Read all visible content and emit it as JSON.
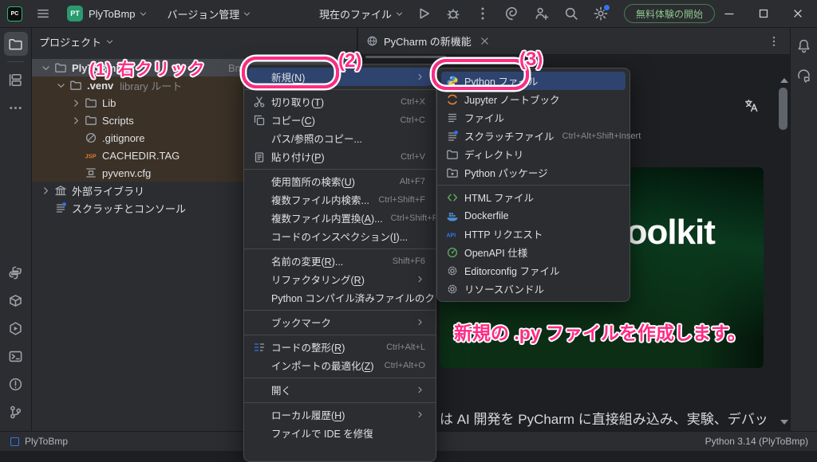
{
  "titlebar": {
    "left_icons": [
      "pycharm-logo",
      "main-menu"
    ],
    "logo_text": "PC",
    "project_chip": "PT",
    "project_name": "PlyToBmp",
    "vcs_label": "バージョン管理",
    "run_config_label": "現在のファイル",
    "action_icons": [
      "run",
      "debug",
      "more-actions",
      "ai-assistant",
      "code-with-me",
      "search-everywhere",
      "settings"
    ],
    "trial_label": "無料体験の開始",
    "window_icons": [
      "minimize",
      "maximize",
      "close"
    ]
  },
  "left_toolbar": {
    "top_primary": [
      "project-folder"
    ],
    "top_secondary": [
      "commit",
      "more-tools"
    ],
    "bottom": [
      "python-console",
      "python-packages",
      "services",
      "terminal",
      "problems",
      "version-control"
    ]
  },
  "right_toolbar": [
    "notifications-bell",
    "ai-assistant-chat"
  ],
  "project_panel": {
    "header": "プロジェクト",
    "tree": [
      {
        "label": "PlyToBmp",
        "level": 0,
        "icon": "folder",
        "chevron": "down",
        "selected": true,
        "bold": true,
        "path_fragment": "Bmp"
      },
      {
        "label": ".venv",
        "suffix": "library ルート",
        "level": 1,
        "icon": "folder",
        "chevron": "down",
        "bold": true
      },
      {
        "label": "Lib",
        "level": 2,
        "icon": "folder",
        "chevron": "right"
      },
      {
        "label": "Scripts",
        "level": 2,
        "icon": "folder",
        "chevron": "right"
      },
      {
        "label": ".gitignore",
        "level": 2,
        "icon": "ignore"
      },
      {
        "label": "CACHEDIR.TAG",
        "level": 2,
        "icon": "jsp"
      },
      {
        "label": "pyvenv.cfg",
        "level": 2,
        "icon": "config"
      },
      {
        "label": "外部ライブラリ",
        "level": 0,
        "icon": "library",
        "chevron": "right"
      },
      {
        "label": "スクラッチとコンソール",
        "level": 0,
        "icon": "scratches"
      }
    ]
  },
  "context_menu": {
    "items": [
      {
        "label": "新規(N)",
        "submenu": true,
        "selected": true
      },
      {
        "sep": true
      },
      {
        "icon": "cut",
        "label": "切り取り(T)",
        "shortcut": "Ctrl+X"
      },
      {
        "icon": "copy",
        "label": "コピー(C)",
        "shortcut": "Ctrl+C"
      },
      {
        "label": "パス/参照のコピー..."
      },
      {
        "icon": "paste",
        "label": "貼り付け(P)",
        "shortcut": "Ctrl+V"
      },
      {
        "sep": true
      },
      {
        "label": "使用箇所の検索(U)",
        "shortcut": "Alt+F7"
      },
      {
        "label": "複数ファイル内検索...",
        "shortcut": "Ctrl+Shift+F"
      },
      {
        "label": "複数ファイル内置換(A)...",
        "shortcut": "Ctrl+Shift+R"
      },
      {
        "label": "コードのインスペクション(I)..."
      },
      {
        "sep": true
      },
      {
        "label": "名前の変更(R)...",
        "shortcut": "Shift+F6"
      },
      {
        "label": "リファクタリング(R)",
        "submenu": true
      },
      {
        "label": "Python コンパイル済みファイルのクリーン"
      },
      {
        "sep": true
      },
      {
        "label": "ブックマーク",
        "submenu": true
      },
      {
        "sep": true
      },
      {
        "icon": "format",
        "label": "コードの整形(R)",
        "shortcut": "Ctrl+Alt+L"
      },
      {
        "label": "インポートの最適化(Z)",
        "shortcut": "Ctrl+Alt+O"
      },
      {
        "sep": true
      },
      {
        "label": "開く",
        "submenu": true
      },
      {
        "sep": true
      },
      {
        "label": "ローカル履歴(H)",
        "submenu": true
      },
      {
        "label": "ファイルで IDE を修復"
      }
    ]
  },
  "new_submenu": {
    "items": [
      {
        "icon": "python",
        "label": "Python ファイル",
        "selected": true
      },
      {
        "icon": "jupyter",
        "label": "Jupyter ノートブック"
      },
      {
        "icon": "file",
        "label": "ファイル"
      },
      {
        "icon": "scratch",
        "label": "スクラッチファイル",
        "shortcut": "Ctrl+Alt+Shift+Insert"
      },
      {
        "icon": "directory",
        "label": "ディレクトリ"
      },
      {
        "icon": "package",
        "label": "Python パッケージ"
      },
      {
        "sep": true
      },
      {
        "icon": "html",
        "label": "HTML ファイル"
      },
      {
        "icon": "docker",
        "label": "Dockerfile"
      },
      {
        "icon": "api",
        "label": "HTTP リクエスト"
      },
      {
        "icon": "openapi",
        "label": "OpenAPI 仕様"
      },
      {
        "icon": "gear",
        "label": "Editorconfig ファイル"
      },
      {
        "icon": "gear",
        "label": "リソースバンドル"
      }
    ]
  },
  "editor": {
    "tab_title": "PyCharm の新機能",
    "tab_icons": [
      "globe",
      "close"
    ],
    "more_icon": "more-vertical",
    "translate_icon": "translate",
    "hero_heading": "Toolkit",
    "paragraph": "は AI 開発を PyCharm に直接組み込み、実験、デバッ"
  },
  "annotations": {
    "step1": "(1) 右クリック",
    "step2": "(2)",
    "step3": "(3)",
    "note": "新規の .py ファイルを作成します。"
  },
  "statusbar": {
    "left_project": "PlyToBmp",
    "interpreter": "Python 3.14 (PlyToBmp)"
  },
  "colors": {
    "annotation_pink": "#ff2b85",
    "menu_selection_blue": "#2e436e",
    "trial_green": "#8bc48d",
    "library_row_brown": "#3b3126",
    "badge_blue": "#3574f0"
  }
}
